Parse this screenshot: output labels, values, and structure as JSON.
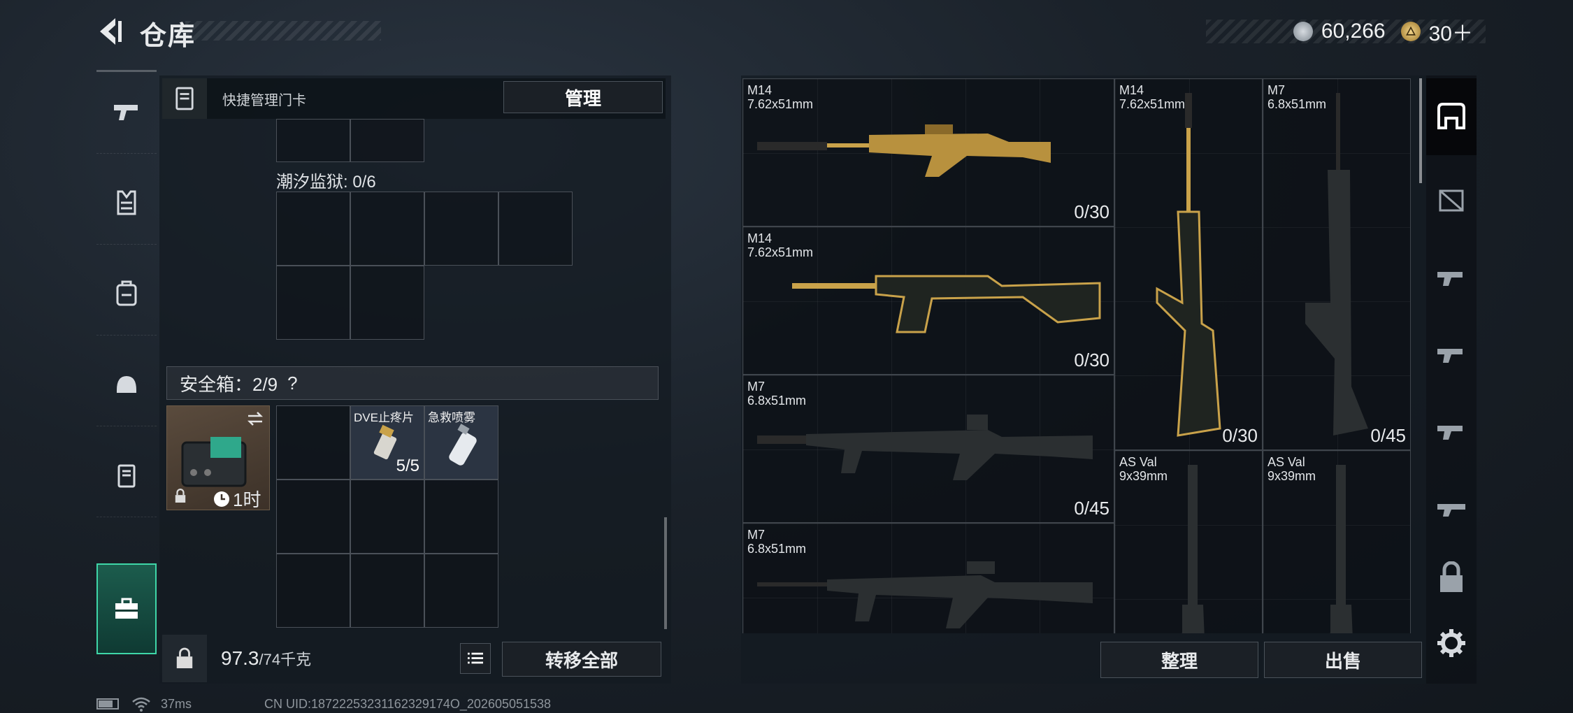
{
  "header": {
    "title": "仓库",
    "currencies": [
      {
        "icon": "silver-coin-icon",
        "value": "60,266"
      },
      {
        "icon": "gold-triangle-coin-icon",
        "value": "30＋"
      }
    ]
  },
  "left_nav": [
    "pistol-icon",
    "vest-icon",
    "backpack-icon",
    "helmet-icon",
    "keycard-case-icon",
    "toolbox-icon"
  ],
  "quick_card": {
    "label": "快捷管理门卡",
    "manage_button": "管理"
  },
  "tidal_prison": {
    "label": "潮汐监狱: 0/6"
  },
  "safe_box": {
    "label": "安全箱：2/9",
    "help": "?",
    "container_timer": "1时",
    "items": [
      {
        "name": "DVE止疼片",
        "count": "5/5"
      },
      {
        "name": "急救喷雾",
        "count": ""
      }
    ]
  },
  "footer_left": {
    "weight_value": "97.3",
    "weight_unit": "/74千克",
    "transfer_all": "转移全部"
  },
  "weapons": [
    {
      "name": "M14",
      "caliber": "7.62x51mm",
      "ammo": "0/30"
    },
    {
      "name": "M14",
      "caliber": "7.62x51mm",
      "ammo": "0/30"
    },
    {
      "name": "M7",
      "caliber": "6.8x51mm",
      "ammo": "0/45"
    },
    {
      "name": "M7",
      "caliber": "6.8x51mm",
      "ammo": ""
    },
    {
      "name": "M14",
      "caliber": "7.62x51mm",
      "ammo": "0/30"
    },
    {
      "name": "M7",
      "caliber": "6.8x51mm",
      "ammo": "0/45"
    },
    {
      "name": "AS Val",
      "caliber": "9x39mm",
      "ammo": ""
    },
    {
      "name": "AS Val",
      "caliber": "9x39mm",
      "ammo": ""
    }
  ],
  "footer_right": {
    "sort": "整理",
    "sell": "出售"
  },
  "status": {
    "ping": "37ms",
    "uid": "CN UID:18722253231162329174O_202605051538"
  },
  "colors": {
    "accent": "#3fd6a8",
    "gold": "#c9a24a"
  }
}
